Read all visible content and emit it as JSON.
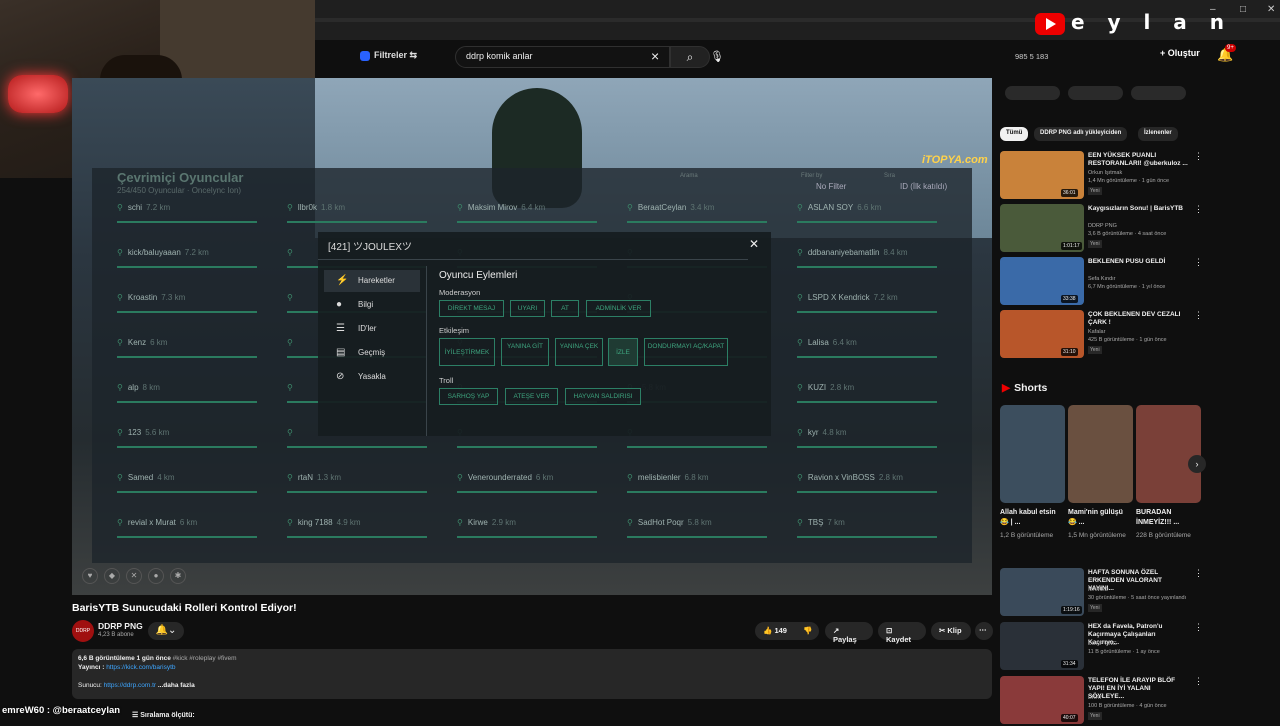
{
  "streamer_overlay": {
    "brand": "e y l a n",
    "chat_line": "emreW60 : @beraatceylan"
  },
  "youtube_header": {
    "filters_label": "Filtreler",
    "search_value": "ddrp komik anlar",
    "stats": "985  5  183",
    "create_label": "Oluştur",
    "notif_badge": "9+"
  },
  "video": {
    "watermark": "iTOPYA.com",
    "hud": {
      "title": "Çevrimiçi Oyuncular",
      "subtitle": "254/450 Oyuncular · Oncelync Ion)",
      "search_label": "Arama",
      "filter_label": "Filter by",
      "filter_value": "No Filter",
      "sort_label": "Sıra",
      "sort_value": "ID (İlk katıldı)"
    },
    "players": [
      {
        "name": "schi",
        "dist": "7.2 km"
      },
      {
        "name": "llbr0k",
        "dist": "1.8 km"
      },
      {
        "name": "Maksim Mirov",
        "dist": "6.4 km"
      },
      {
        "name": "BeraatCeylan",
        "dist": "3.4 km"
      },
      {
        "name": "ASLAN SOY",
        "dist": "6.6 km"
      },
      {
        "name": "kick/baluyaaan",
        "dist": "7.2 km"
      },
      {
        "name": "",
        "dist": ""
      },
      {
        "name": "",
        "dist": ""
      },
      {
        "name": "",
        "dist": ""
      },
      {
        "name": "ddbananiyebamatlin",
        "dist": "8.4 km"
      },
      {
        "name": "Kroastin",
        "dist": "7.3 km"
      },
      {
        "name": "",
        "dist": ""
      },
      {
        "name": "",
        "dist": ""
      },
      {
        "name": "",
        "dist": ""
      },
      {
        "name": "LSPD X Kendrick",
        "dist": "7.2 km"
      },
      {
        "name": "Kenz",
        "dist": "6 km"
      },
      {
        "name": "",
        "dist": ""
      },
      {
        "name": "",
        "dist": ""
      },
      {
        "name": "",
        "dist": ""
      },
      {
        "name": "Lalisa",
        "dist": "6.4 km"
      },
      {
        "name": "alp",
        "dist": "8 km"
      },
      {
        "name": "",
        "dist": ""
      },
      {
        "name": "",
        "dist": ""
      },
      {
        "name": "",
        "dist": "5.8 km"
      },
      {
        "name": "KUZI",
        "dist": "2.8 km"
      },
      {
        "name": "123",
        "dist": "5.6 km"
      },
      {
        "name": "",
        "dist": ""
      },
      {
        "name": "",
        "dist": ""
      },
      {
        "name": "",
        "dist": ""
      },
      {
        "name": "kyr",
        "dist": "4.8 km"
      },
      {
        "name": "Samed",
        "dist": "4 km"
      },
      {
        "name": "rtaN",
        "dist": "1.3 km"
      },
      {
        "name": "Venerounderrated",
        "dist": "6 km"
      },
      {
        "name": "melisbienler",
        "dist": "6.8 km"
      },
      {
        "name": "Ravion x VinBOSS",
        "dist": "2.8 km"
      },
      {
        "name": "revial x Murat",
        "dist": "6 km"
      },
      {
        "name": "king 7188",
        "dist": "4.9 km"
      },
      {
        "name": "Kirwe",
        "dist": "2.9 km"
      },
      {
        "name": "SadHot Poqr",
        "dist": "5.8 km"
      },
      {
        "name": "TBŞ",
        "dist": "7 km"
      }
    ],
    "modal": {
      "title": "[421] ツJOULEXツ",
      "sidebar": [
        {
          "label": "Hareketler",
          "icon": "⚡"
        },
        {
          "label": "Bilgi",
          "icon": "●"
        },
        {
          "label": "ID'ler",
          "icon": "☰"
        },
        {
          "label": "Geçmiş",
          "icon": "▤"
        },
        {
          "label": "Yasakla",
          "icon": "⊘"
        }
      ],
      "section_title": "Oyuncu Eylemleri",
      "group_moderation": "Moderasyon",
      "moderation_buttons": [
        "DİREKT MESAJ",
        "UYARI",
        "AT",
        "ADMİNLİK VER"
      ],
      "group_interaction": "Etkileşim",
      "interaction_buttons": [
        "İYİLEŞTİRMEK",
        "YANINA GİT",
        "YANINA ÇEK",
        "İZLE",
        "DONDURMAYI AÇ/KAPAT"
      ],
      "group_troll": "Troll",
      "troll_buttons": [
        "SARHOŞ YAP",
        "ATEŞE VER",
        "HAYVAN SALDIRISI"
      ]
    }
  },
  "video_info": {
    "title": "BarisYTB Sunucudaki Rolleri Kontrol Ediyor!",
    "channel_name": "DDRP PNG",
    "channel_subs": "4,23 B abone",
    "likes": "149",
    "share": "Paylaş",
    "save": "Kaydet",
    "clip": "Klip",
    "desc_meta": "6,6 B görüntüleme  1 gün önce",
    "desc_tags": "#kick #roleplay #fivem",
    "desc_streamer_label": "Yayıncı : ",
    "desc_streamer_link": "https://kick.com/barisytb",
    "desc_server_label": "Sunucu: ",
    "desc_server_link": "https://ddrp.com.tr",
    "desc_more": "...daha fazla",
    "sort_label": "Sıralama ölçütü:"
  },
  "sidebar": {
    "chips": [
      "Tümü",
      "DDRP PNG adlı yükleyiciden",
      "İzlenenler"
    ],
    "videos_top": [
      {
        "title": "EEN YÜKSEK PUANLI RESTORANLARI! @uberkuloz ...",
        "channel": "Orkun Işıtmak",
        "meta": "1,4 Mn görüntüleme · 1 gün önce",
        "badge": "Yeni",
        "dur": "36:01",
        "color": "#c9823a"
      },
      {
        "title": "Kaygısızların Sonu! | BarisYTB",
        "channel": "DDRP PNG",
        "meta": "3,6 B görüntüleme · 4 saat önce",
        "badge": "Yeni",
        "dur": "1:01:17",
        "color": "#4a5a3a"
      },
      {
        "title": "BEKLENEN PUSU GELDİ",
        "channel": "Sefa Kındır",
        "meta": "6,7 Mn görüntüleme · 1 yıl önce",
        "badge": "",
        "dur": "33:38",
        "color": "#3a6aa8"
      },
      {
        "title": "ÇOK BEKLENEN DEV CEZALI ÇARK !",
        "channel": "Kafalar",
        "meta": "425 B görüntüleme · 1 gün önce",
        "badge": "Yeni",
        "dur": "31:10",
        "color": "#b8562a"
      }
    ],
    "shorts_heading": "Shorts",
    "shorts": [
      {
        "title": "Allah kabul etsin 😂 | ...",
        "views": "1,2 B görüntüleme",
        "color": "#3c4e5e"
      },
      {
        "title": "Mami'nin gülüşü 😂 ...",
        "views": "1,5 Mn görüntüleme",
        "color": "#6a5040"
      },
      {
        "title": "BURADAN İNMEYİZ!!! ...",
        "views": "228 B görüntüleme",
        "color": "#7a4038"
      }
    ],
    "videos_bottom": [
      {
        "title": "HAFTA SONUNA ÖZEL ERKENDEN VALORANT YAYINI...",
        "channel": "MAMED",
        "meta": "30 görüntüleme · 5 saat önce yayınlandı",
        "badge": "Yeni",
        "dur": "1:19:16",
        "color": "#3a4a5a"
      },
      {
        "title": "HEX da Favela, Patron'u Kaçırmaya Çalışanları Kaçırıyo...",
        "channel": "DDRP PNG",
        "meta": "11 B görüntüleme · 1 ay önce",
        "badge": "",
        "dur": "31:34",
        "color": "#2a3038"
      },
      {
        "title": "TELEFON İLE ARAYIP BLÖF YAPI! EN İYİ YALANI SÖYLEYE...",
        "channel": "ERAY",
        "meta": "100 B görüntüleme · 4 gün önce",
        "badge": "Yeni",
        "dur": "40:07",
        "color": "#8a3a3a"
      }
    ]
  }
}
